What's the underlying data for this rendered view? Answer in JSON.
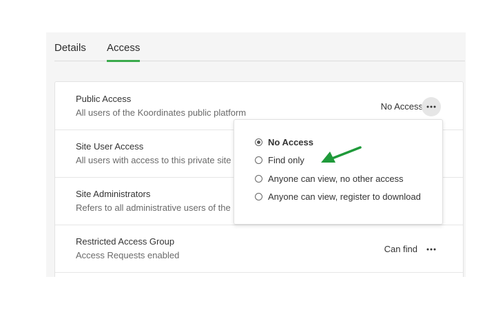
{
  "tabs": [
    {
      "label": "Details",
      "active": false
    },
    {
      "label": "Access",
      "active": true
    }
  ],
  "accent_color": "#3aaa4c",
  "arrow_color": "#1f9a3a",
  "rows": [
    {
      "title": "Public Access",
      "subtitle": "All users of the Koordinates public platform",
      "status": "No Access",
      "menu_icon": "more-horizontal-icon"
    },
    {
      "title": "Site User Access",
      "subtitle": "All users with access to this private site",
      "status": "",
      "menu_icon": "more-horizontal-icon"
    },
    {
      "title": "Site Administrators",
      "subtitle": "Refers to all administrative users of the",
      "status": "",
      "menu_icon": "more-horizontal-icon"
    },
    {
      "title": "Restricted Access Group",
      "subtitle": "Access Requests enabled",
      "status": "Can find",
      "menu_icon": "more-horizontal-icon"
    }
  ],
  "dropdown": {
    "options": [
      {
        "label": "No Access",
        "selected": true
      },
      {
        "label": "Find only",
        "selected": false
      },
      {
        "label": "Anyone can view, no other access",
        "selected": false
      },
      {
        "label": "Anyone can view, register to download",
        "selected": false
      }
    ]
  }
}
